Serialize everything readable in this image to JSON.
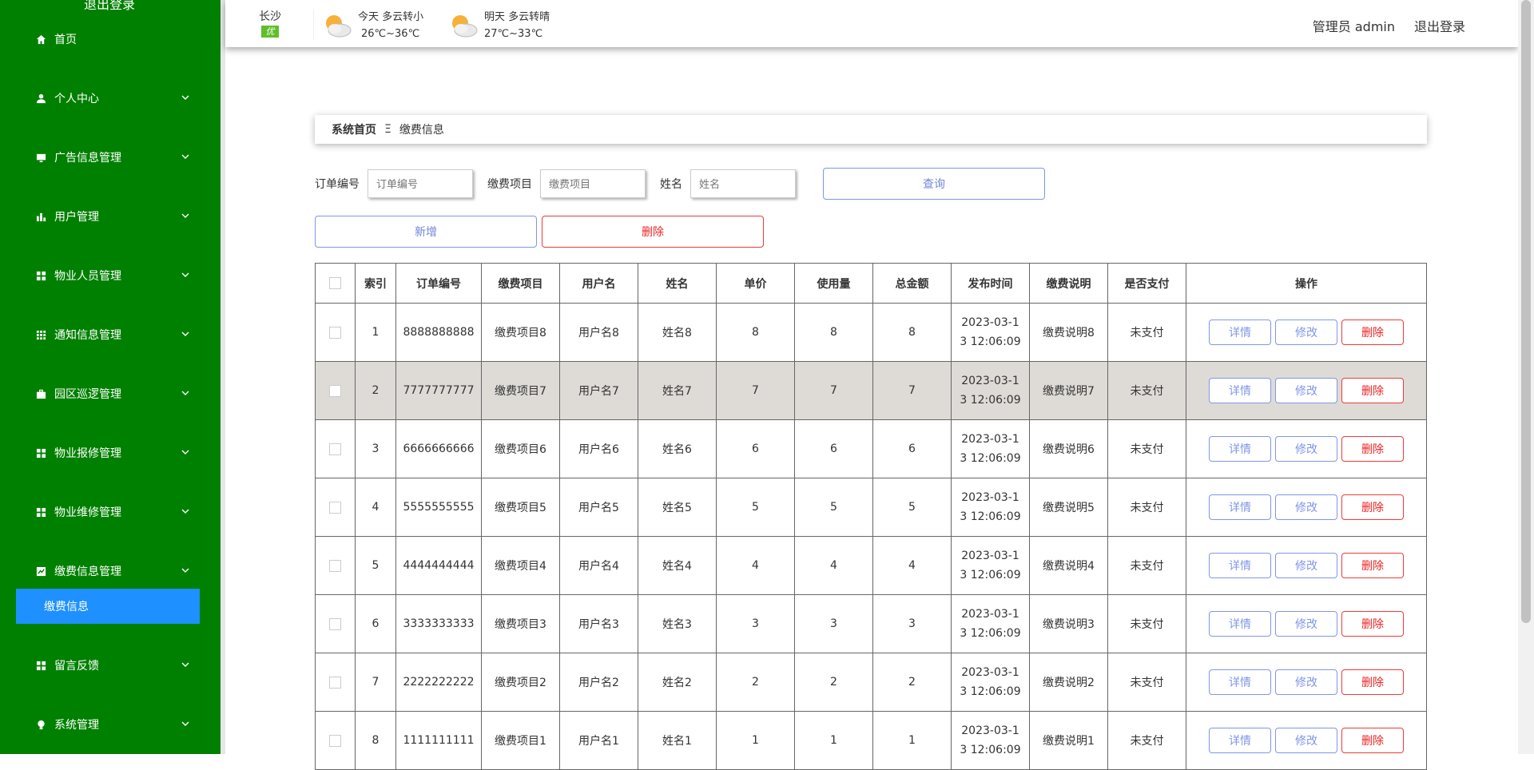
{
  "sidebar": {
    "top_label": "退出登录",
    "items": [
      {
        "label": "首页",
        "icon": "home-icon"
      },
      {
        "label": "个人中心",
        "icon": "user-icon"
      },
      {
        "label": "广告信息管理",
        "icon": "monitor-icon"
      },
      {
        "label": "用户管理",
        "icon": "bar-chart-icon"
      },
      {
        "label": "物业人员管理",
        "icon": "grid-icon"
      },
      {
        "label": "通知信息管理",
        "icon": "grid-dots-icon"
      },
      {
        "label": "园区巡逻管理",
        "icon": "briefcase-icon"
      },
      {
        "label": "物业报修管理",
        "icon": "grid-icon"
      },
      {
        "label": "物业维修管理",
        "icon": "grid-icon"
      },
      {
        "label": "缴费信息管理",
        "icon": "chart-icon"
      },
      {
        "label": "留言反馈",
        "icon": "grid-icon"
      },
      {
        "label": "系统管理",
        "icon": "bulb-icon"
      }
    ],
    "active_sub": "缴费信息"
  },
  "header": {
    "city": "长沙",
    "aqi": "优",
    "today": {
      "line1": "今天  多云转小",
      "line2": "26℃~36℃"
    },
    "tomorrow": {
      "line1": "明天  多云转晴",
      "line2": "27℃~33℃"
    },
    "admin": "管理员 admin",
    "logout": "退出登录"
  },
  "breadcrumb": {
    "home": "系统首页",
    "sep": "Ξ",
    "current": "缴费信息"
  },
  "search": {
    "order_label": "订单编号",
    "order_placeholder": "订单编号",
    "item_label": "缴费项目",
    "item_placeholder": "缴费项目",
    "name_label": "姓名",
    "name_placeholder": "姓名",
    "query": "查询"
  },
  "actions": {
    "add": "新增",
    "delete": "删除"
  },
  "table": {
    "headers": [
      "索引",
      "订单编号",
      "缴费项目",
      "用户名",
      "姓名",
      "单价",
      "使用量",
      "总金额",
      "发布时间",
      "缴费说明",
      "是否支付",
      "操作"
    ],
    "op_labels": {
      "detail": "详情",
      "edit": "修改",
      "delete": "删除"
    },
    "rows": [
      {
        "idx": "1",
        "order": "8888888888",
        "item": "缴费项目8",
        "user": "用户名8",
        "name": "姓名8",
        "price": "8",
        "usage": "8",
        "total": "8",
        "time": "2023-03-13 12:06:09",
        "desc": "缴费说明8",
        "paid": "未支付"
      },
      {
        "idx": "2",
        "order": "7777777777",
        "item": "缴费项目7",
        "user": "用户名7",
        "name": "姓名7",
        "price": "7",
        "usage": "7",
        "total": "7",
        "time": "2023-03-13 12:06:09",
        "desc": "缴费说明7",
        "paid": "未支付"
      },
      {
        "idx": "3",
        "order": "6666666666",
        "item": "缴费项目6",
        "user": "用户名6",
        "name": "姓名6",
        "price": "6",
        "usage": "6",
        "total": "6",
        "time": "2023-03-13 12:06:09",
        "desc": "缴费说明6",
        "paid": "未支付"
      },
      {
        "idx": "4",
        "order": "5555555555",
        "item": "缴费项目5",
        "user": "用户名5",
        "name": "姓名5",
        "price": "5",
        "usage": "5",
        "total": "5",
        "time": "2023-03-13 12:06:09",
        "desc": "缴费说明5",
        "paid": "未支付"
      },
      {
        "idx": "5",
        "order": "4444444444",
        "item": "缴费项目4",
        "user": "用户名4",
        "name": "姓名4",
        "price": "4",
        "usage": "4",
        "total": "4",
        "time": "2023-03-13 12:06:09",
        "desc": "缴费说明4",
        "paid": "未支付"
      },
      {
        "idx": "6",
        "order": "3333333333",
        "item": "缴费项目3",
        "user": "用户名3",
        "name": "姓名3",
        "price": "3",
        "usage": "3",
        "total": "3",
        "time": "2023-03-13 12:06:09",
        "desc": "缴费说明3",
        "paid": "未支付"
      },
      {
        "idx": "7",
        "order": "2222222222",
        "item": "缴费项目2",
        "user": "用户名2",
        "name": "姓名2",
        "price": "2",
        "usage": "2",
        "total": "2",
        "time": "2023-03-13 12:06:09",
        "desc": "缴费说明2",
        "paid": "未支付"
      },
      {
        "idx": "8",
        "order": "1111111111",
        "item": "缴费项目1",
        "user": "用户名1",
        "name": "姓名1",
        "price": "1",
        "usage": "1",
        "total": "1",
        "time": "2023-03-13 12:06:09",
        "desc": "缴费说明1",
        "paid": "未支付"
      }
    ]
  },
  "colors": {
    "sidebar": "#008000",
    "active": "#1e90ff",
    "blue_btn": "#7f96e8",
    "red_btn": "#ee3b3b",
    "highlight_row": "#dedbd7"
  }
}
